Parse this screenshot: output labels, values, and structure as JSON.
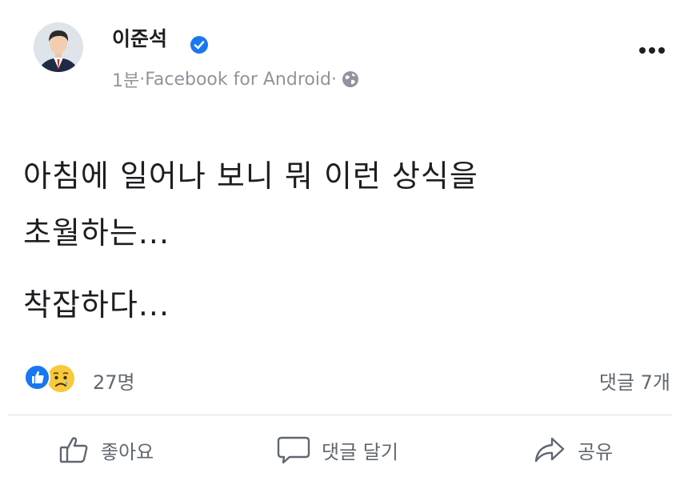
{
  "post": {
    "author": "이준석",
    "time": "1분",
    "separator": " · ",
    "source": "Facebook for Android",
    "privacy_icon": "globe-icon",
    "lines": [
      "아침에 일어나 보니 뭐 이런 상식을",
      "초월하는...",
      "착잡하다..."
    ]
  },
  "reactions": {
    "icons": [
      "like-icon",
      "sad-icon"
    ],
    "count": "27명",
    "comments": "댓글 7개"
  },
  "actions": {
    "like": "좋아요",
    "comment": "댓글 달기",
    "share": "공유"
  },
  "colors": {
    "accent": "#1877f2",
    "meta": "#90949c",
    "text": "#1c1e21"
  }
}
